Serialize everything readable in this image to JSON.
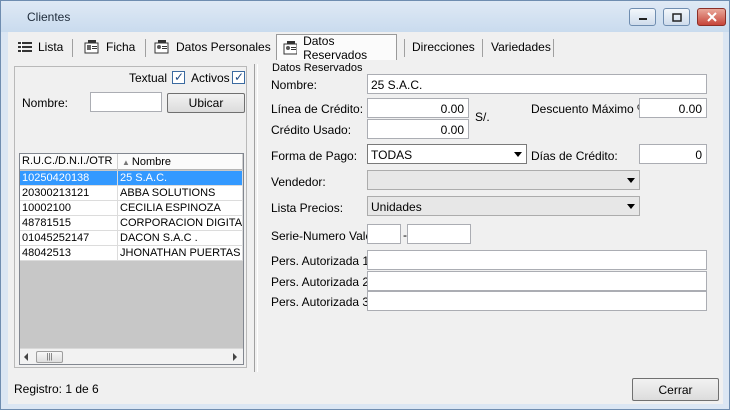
{
  "window": {
    "title": "Clientes"
  },
  "tabs": [
    {
      "label": "Lista",
      "icon": "list-icon"
    },
    {
      "label": "Ficha",
      "icon": "card-icon"
    },
    {
      "label": "Datos Personales",
      "icon": "person-card-icon"
    },
    {
      "label": "Datos Reservados",
      "icon": "person-card-icon"
    },
    {
      "label": "Direcciones"
    },
    {
      "label": "Variedades"
    }
  ],
  "left": {
    "textual_label": "Textual",
    "activos_label": "Activos",
    "nombre_label": "Nombre:",
    "nombre_value": "",
    "ubicar_label": "Ubicar",
    "columns": [
      "R.U.C./D.N.I./OTR",
      "Nombre"
    ],
    "rows": [
      [
        "10250420138",
        "25 S.A.C."
      ],
      [
        "20300213121",
        "ABBA SOLUTIONS"
      ],
      [
        "10002100",
        "CECILIA ESPINOZA"
      ],
      [
        "48781515",
        "CORPORACION DIGITAX"
      ],
      [
        "01045252147",
        "DACON S.A.C ."
      ],
      [
        "48042513",
        "JHONATHAN PUERTAS"
      ]
    ]
  },
  "form": {
    "group_title": "Datos Reservados",
    "nombre_label": "Nombre:",
    "nombre_value": "25 S.A.C.",
    "linea_label": "Línea de Crédito:",
    "linea_value": "0.00",
    "currency": "S/.",
    "descuento_label": "Descuento Máximo %:",
    "descuento_value": "0.00",
    "credito_usado_label": "Crédito Usado:",
    "credito_usado_value": "0.00",
    "forma_pago_label": "Forma de Pago:",
    "forma_pago_value": "TODAS",
    "dias_credito_label": "Días de Crédito:",
    "dias_credito_value": "0",
    "vendedor_label": "Vendedor:",
    "vendedor_value": "",
    "lista_precios_label": "Lista Precios:",
    "lista_precios_value": "Unidades",
    "serie_label": "Serie-Numero Vale:",
    "serie_value": "",
    "serie_sep": "-",
    "numero_value": "",
    "pers1_label": "Pers. Autorizada 1:",
    "pers1_value": "",
    "pers2_label": "Pers. Autorizada 2:",
    "pers2_value": "",
    "pers3_label": "Pers. Autorizada 3:",
    "pers3_value": ""
  },
  "footer": {
    "registro": "Registro: 1 de 6",
    "cerrar_label": "Cerrar"
  }
}
